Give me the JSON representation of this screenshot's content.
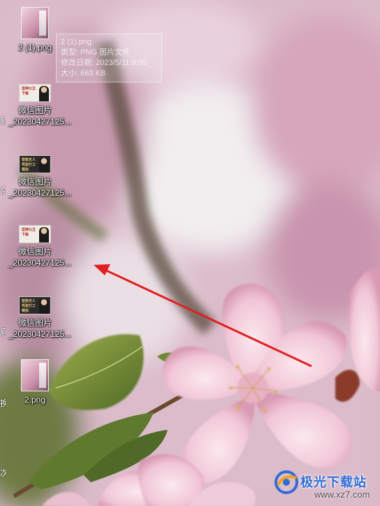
{
  "desktop": {
    "icons": [
      {
        "label": "2 (1).png",
        "type": "png"
      },
      {
        "label": "微信图片_20230427125...",
        "type": "wx",
        "variant": "red",
        "thumb_text": "坚持公立下级"
      },
      {
        "label": "微信图片_20230427125...",
        "type": "wx",
        "variant": "dark",
        "thumb_text": "智能无人驾驶打工模拟"
      },
      {
        "label": "微信图片_20230427125...",
        "type": "wx",
        "variant": "red",
        "thumb_text": "坚持公立下级"
      },
      {
        "label": "微信图片_20230427125...",
        "type": "wx",
        "variant": "dark",
        "thumb_text": "智能无人驾驶打工模拟"
      },
      {
        "label": "2.png",
        "type": "png"
      }
    ],
    "left_fragments": [
      "肩",
      "京",
      "肩",
      "换",
      "次"
    ]
  },
  "tooltip": {
    "name": "2 (1).png",
    "type": "类型: PNG 图片文件",
    "modified": "修改日期: 2023/5/11 9:05",
    "size": "大小: 663 KB"
  },
  "watermark": {
    "title": "极光下载站",
    "url": "www.xz7.com"
  },
  "annotation": {
    "arrow_color": "#e02020"
  }
}
